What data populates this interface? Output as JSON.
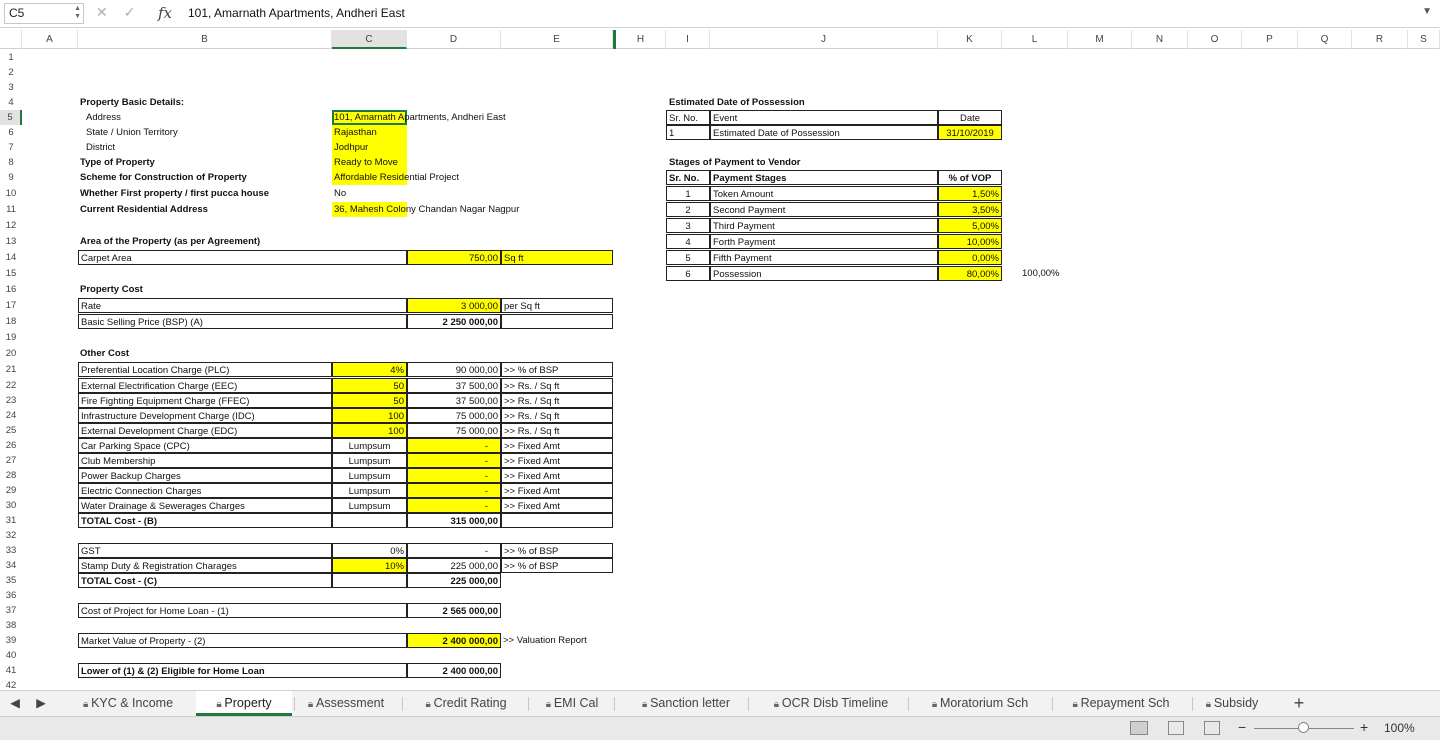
{
  "formula_bar": {
    "name_box": "C5",
    "fx": "fx",
    "content": "101, Amarnath Apartments, Andheri East"
  },
  "columns": [
    "A",
    "B",
    "C",
    "D",
    "E",
    "",
    "H",
    "I",
    "J",
    "K",
    "L",
    "M",
    "N",
    "O",
    "P",
    "Q",
    "R",
    "S"
  ],
  "rows": [
    "1",
    "2",
    "3",
    "4",
    "5",
    "6",
    "7",
    "8",
    "9",
    "10",
    "11",
    "12",
    "13",
    "14",
    "15",
    "16",
    "17",
    "18",
    "19",
    "20",
    "21",
    "22",
    "23",
    "24",
    "25",
    "26",
    "27",
    "28",
    "29",
    "30",
    "31",
    "32",
    "33",
    "34",
    "35",
    "36",
    "37",
    "38",
    "39",
    "40",
    "41",
    "42"
  ],
  "property": {
    "basic_title": "Property Basic Details:",
    "address_label": "Address",
    "address_value": "101, Amarnath Apartments, Andheri East",
    "state_label": "State / Union Territory",
    "state_value": "Rajasthan",
    "district_label": "District",
    "district_value": "Jodhpur",
    "type_label": "Type of Property",
    "type_value": "Ready to Move",
    "scheme_label": "Scheme for Construction of Property",
    "scheme_value": "Affordable Residential Project",
    "first_label": "Whether First property / first pucca house",
    "first_value": "No",
    "current_label": "Current Residential Address",
    "current_value": "36, Mahesh Colony Chandan Nagar Nagpur"
  },
  "area": {
    "title": "Area of the Property (as per Agreement)",
    "label": "Carpet Area",
    "value": "750,00",
    "unit": "Sq ft"
  },
  "cost": {
    "title": "Property Cost",
    "rate_label": "Rate",
    "rate_value": "3 000,00",
    "rate_unit": "per Sq ft",
    "bsp_label": "Basic Selling Price (BSP) (A)",
    "bsp_value": "2 250 000,00"
  },
  "other": {
    "title": "Other Cost",
    "items": [
      {
        "label": "Preferential Location Charge (PLC)",
        "rate": "4%",
        "amount": "90 000,00",
        "basis": ">> % of BSP"
      },
      {
        "label": "External Electrification Charge (EEC)",
        "rate": "50",
        "amount": "37 500,00",
        "basis": ">> Rs. / Sq ft"
      },
      {
        "label": "Fire Fighting Equipment Charge (FFEC)",
        "rate": "50",
        "amount": "37 500,00",
        "basis": ">> Rs. / Sq ft"
      },
      {
        "label": "Infrastructure Development Charge (IDC)",
        "rate": "100",
        "amount": "75 000,00",
        "basis": ">> Rs. / Sq ft"
      },
      {
        "label": "External Development Charge (EDC)",
        "rate": "100",
        "amount": "75 000,00",
        "basis": ">> Rs. / Sq ft"
      },
      {
        "label": "Car Parking Space (CPC)",
        "rate": "Lumpsum",
        "amount": "-",
        "basis": ">> Fixed Amt"
      },
      {
        "label": "Club Membership",
        "rate": "Lumpsum",
        "amount": "-",
        "basis": ">> Fixed Amt"
      },
      {
        "label": "Power Backup Charges",
        "rate": "Lumpsum",
        "amount": "-",
        "basis": ">> Fixed Amt"
      },
      {
        "label": "Electric Connection Charges",
        "rate": "Lumpsum",
        "amount": "-",
        "basis": ">> Fixed Amt"
      },
      {
        "label": "Water Drainage & Sewerages Charges",
        "rate": "Lumpsum",
        "amount": "-",
        "basis": ">> Fixed Amt"
      }
    ],
    "total_label": "TOTAL Cost - (B)",
    "total_value": "315 000,00"
  },
  "tax": {
    "gst_label": "GST",
    "gst_rate": "0%",
    "gst_amount": "-",
    "gst_basis": ">> % of BSP",
    "stamp_label": "Stamp Duty & Registration Charages",
    "stamp_rate": "10%",
    "stamp_amount": "225 000,00",
    "stamp_basis": ">> % of BSP",
    "total_label": "TOTAL Cost - (C)",
    "total_value": "225 000,00"
  },
  "summary": {
    "project_label": "Cost of Project for Home Loan - (1)",
    "project_value": "2 565 000,00",
    "market_label": "Market Value of Property - (2)",
    "market_value": "2 400 000,00",
    "market_note": ">> Valuation Report",
    "lower_label": "Lower of (1) & (2) Eligible for Home Loan",
    "lower_value": "2 400 000,00"
  },
  "possession": {
    "title": "Estimated Date of Possession",
    "h_sr": "Sr. No.",
    "h_event": "Event",
    "h_date": "Date",
    "sr": "1",
    "event": "Estimated Date of Possession",
    "date": "31/10/2019"
  },
  "stages": {
    "title": "Stages of Payment to Vendor",
    "h_sr": "Sr. No.",
    "h_stage": "Payment Stages",
    "h_pct": "% of VOP",
    "items": [
      {
        "sr": "1",
        "stage": "Token Amount",
        "pct": "1,50%"
      },
      {
        "sr": "2",
        "stage": "Second Payment",
        "pct": "3,50%"
      },
      {
        "sr": "3",
        "stage": "Third Payment",
        "pct": "5,00%"
      },
      {
        "sr": "4",
        "stage": "Forth Payment",
        "pct": "10,00%"
      },
      {
        "sr": "5",
        "stage": "Fifth Payment",
        "pct": "0,00%"
      },
      {
        "sr": "6",
        "stage": "Possession",
        "pct": "80,00%"
      }
    ],
    "total": "100,00%"
  },
  "tabs": [
    "KYC & Income",
    "Property",
    "Assessment",
    "Credit Rating",
    "EMI Cal",
    "Sanction letter",
    "OCR Disb Timeline",
    "Moratorium Sch",
    "Repayment Sch",
    "Subsidy"
  ],
  "add_sheet": "+",
  "zoom": "100%"
}
